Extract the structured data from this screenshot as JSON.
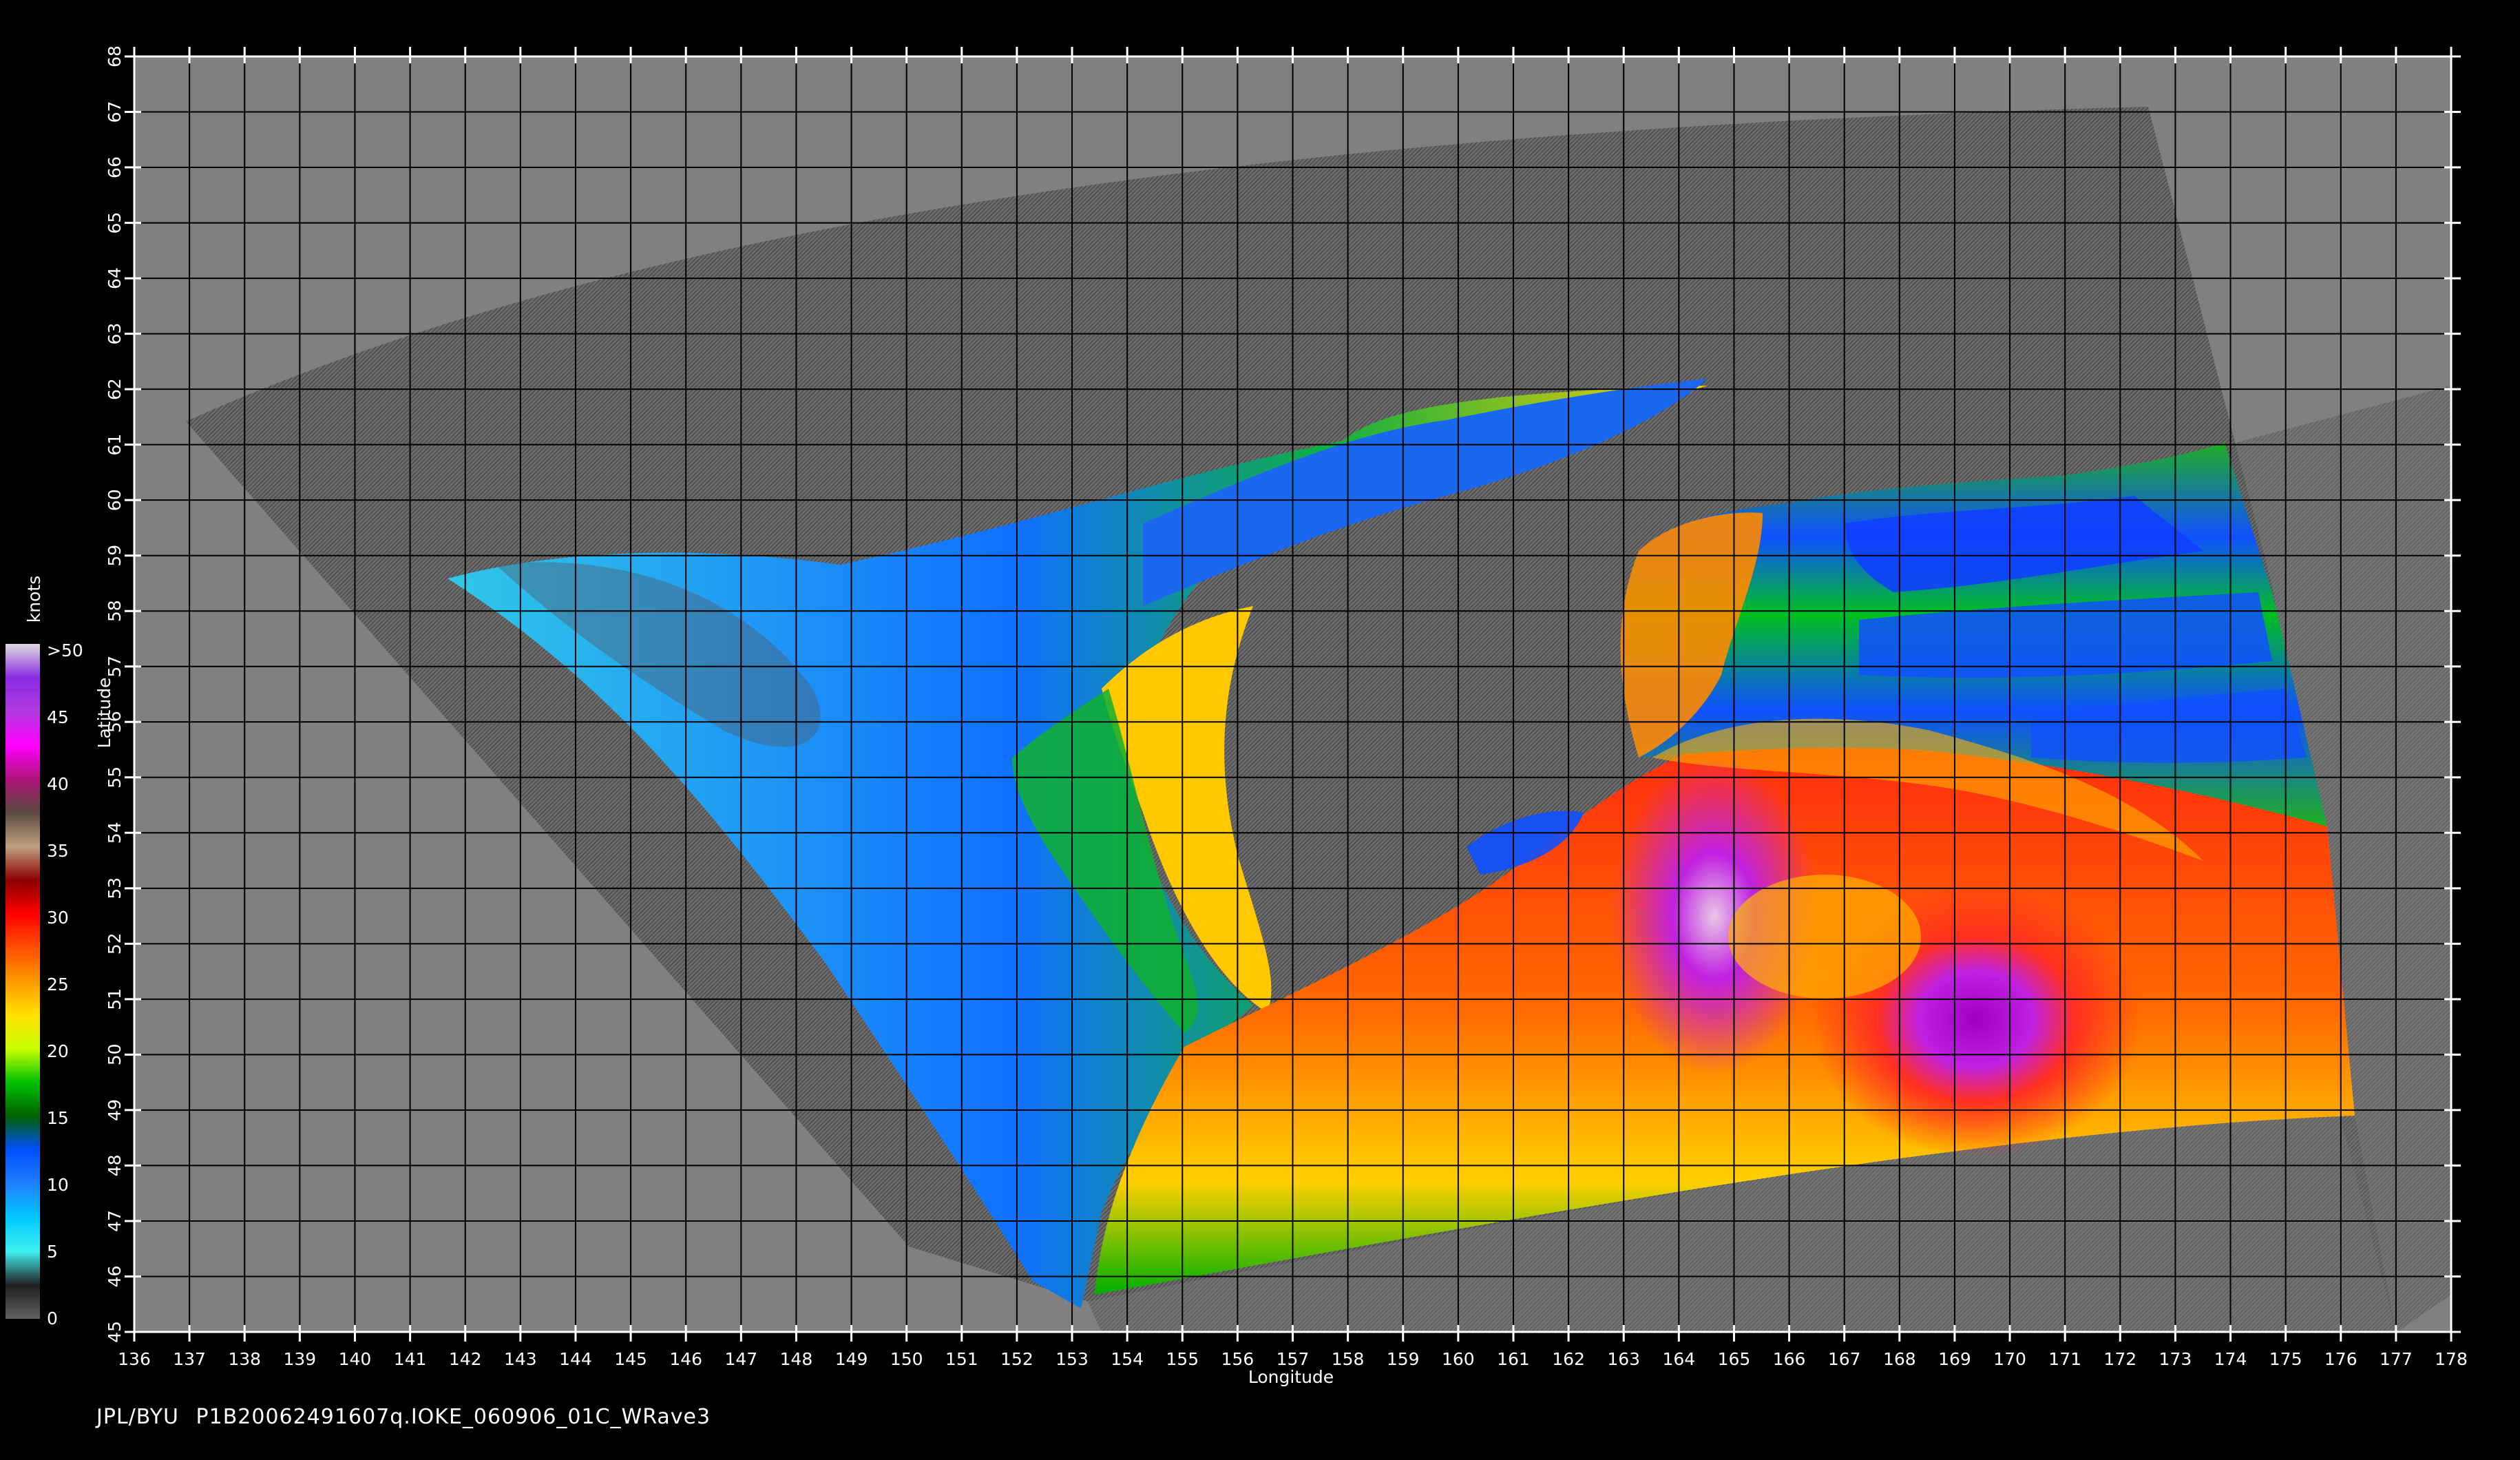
{
  "footer": {
    "source": "JPL/BYU",
    "filename": "P1B20062491607q.IOKE_060906_01C_WRave3"
  },
  "axes": {
    "x_label": "Longitude",
    "y_label": "Latitude",
    "lon_min": 136,
    "lon_max": 178,
    "lat_min": 45,
    "lat_max": 68,
    "lon_ticks": [
      "136",
      "137",
      "138",
      "139",
      "140",
      "141",
      "142",
      "143",
      "144",
      "145",
      "146",
      "147",
      "148",
      "149",
      "150",
      "151",
      "152",
      "153",
      "154",
      "155",
      "156",
      "157",
      "158",
      "159",
      "160",
      "161",
      "162",
      "163",
      "164",
      "165",
      "166",
      "167",
      "168",
      "169",
      "170",
      "171",
      "172",
      "173",
      "174",
      "175",
      "176",
      "177",
      "178"
    ],
    "lat_ticks": [
      "45",
      "46",
      "47",
      "48",
      "49",
      "50",
      "51",
      "52",
      "53",
      "54",
      "55",
      "56",
      "57",
      "58",
      "59",
      "60",
      "61",
      "62",
      "63",
      "64",
      "65",
      "66",
      "67",
      "68"
    ]
  },
  "colorbar": {
    "unit": "knots",
    "labels": [
      ">50",
      "45",
      "40",
      "35",
      "30",
      "25",
      "20",
      "15",
      "10",
      "5",
      "0"
    ],
    "stops": [
      "#dcdcdc",
      "#8a2be2",
      "#b03ae0",
      "#ff00ff",
      "#b0147a",
      "#5a4a40",
      "#c0a080",
      "#8b0000",
      "#ff0000",
      "#ff5000",
      "#ff9a00",
      "#ffe000",
      "#c8ff00",
      "#00c000",
      "#006000",
      "#0050ff",
      "#2080ff",
      "#00c8ff",
      "#40f0f0",
      "#202020",
      "#606060"
    ]
  },
  "colors": {
    "background": "#000000",
    "map_gray": "#808080",
    "swath_gray": "#6e6e6e",
    "grid": "#000000"
  }
}
